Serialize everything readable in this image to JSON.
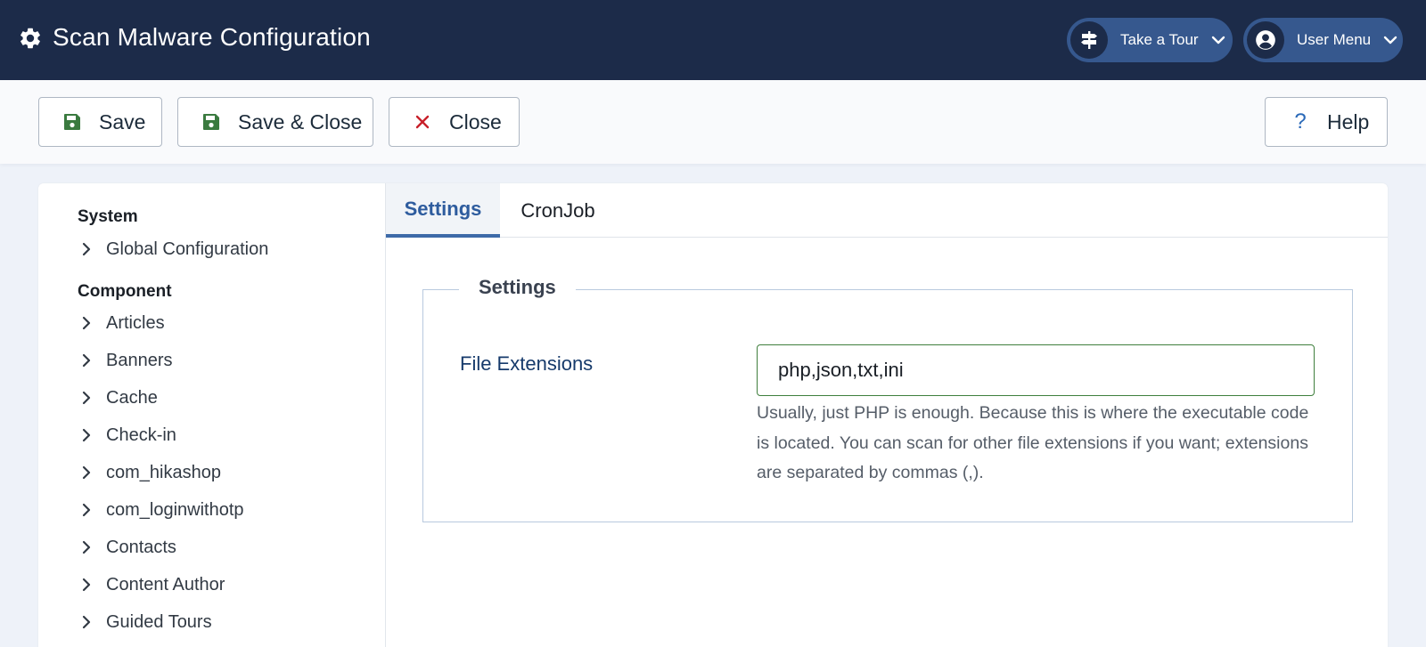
{
  "header": {
    "title": "Scan Malware Configuration",
    "title_icon": "gear-icon",
    "tour": {
      "label": "Take a Tour",
      "icon": "signpost-icon"
    },
    "user_menu": {
      "label": "User Menu",
      "icon": "user-circle-icon"
    }
  },
  "toolbar": {
    "save_label": "Save",
    "save_close_label": "Save & Close",
    "close_label": "Close",
    "help_label": "Help",
    "help_glyph": "?",
    "close_glyph": "✕"
  },
  "sidebar": {
    "groups": [
      {
        "label": "System",
        "items": [
          "Global Configuration"
        ]
      },
      {
        "label": "Component",
        "items": [
          "Articles",
          "Banners",
          "Cache",
          "Check-in",
          "com_hikashop",
          "com_loginwithotp",
          "Contacts",
          "Content Author",
          "Guided Tours"
        ]
      }
    ]
  },
  "tabs": [
    {
      "label": "Settings",
      "active": true
    },
    {
      "label": "CronJob",
      "active": false
    }
  ],
  "form": {
    "legend": "Settings",
    "file_extensions": {
      "label": "File Extensions",
      "value": "php,json,txt,ini",
      "help": "Usually, just PHP is enough. Because this is where the executable code is located. You can scan for other file extensions if you want; extensions are separated by commas (,)."
    }
  },
  "colors": {
    "header_bg": "#1c2b49",
    "pill_bg": "#36588e",
    "save_icon": "#3a7a3f",
    "close_icon": "#c8202a",
    "help_icon": "#2a69b8",
    "tab_active": "#2e5c9e",
    "input_border": "#3f7f3d"
  }
}
